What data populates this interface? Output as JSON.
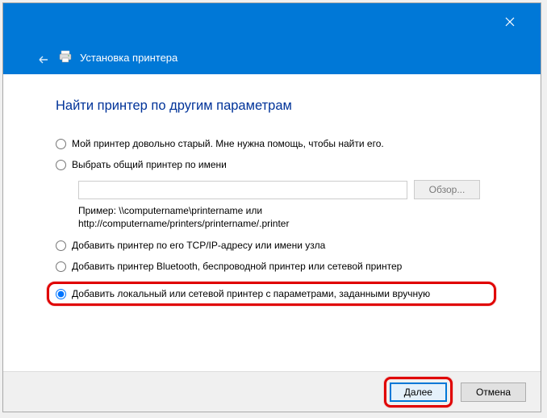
{
  "window": {
    "title": "Установка принтера"
  },
  "heading": "Найти принтер по другим параметрам",
  "options": {
    "old": "Мой принтер довольно старый. Мне нужна помощь, чтобы найти его.",
    "shared": "Выбрать общий принтер по имени",
    "tcpip": "Добавить принтер по его TCP/IP-адресу или имени узла",
    "bluetooth": "Добавить принтер Bluetooth, беспроводной принтер или сетевой принтер",
    "local": "Добавить локальный или сетевой принтер с параметрами, заданными вручную"
  },
  "shared": {
    "value": "",
    "browse": "Обзор...",
    "example_l1": "Пример: \\\\computername\\printername или",
    "example_l2": "http://computername/printers/printername/.printer"
  },
  "selected": "local",
  "footer": {
    "next": "Далее",
    "cancel": "Отмена"
  }
}
